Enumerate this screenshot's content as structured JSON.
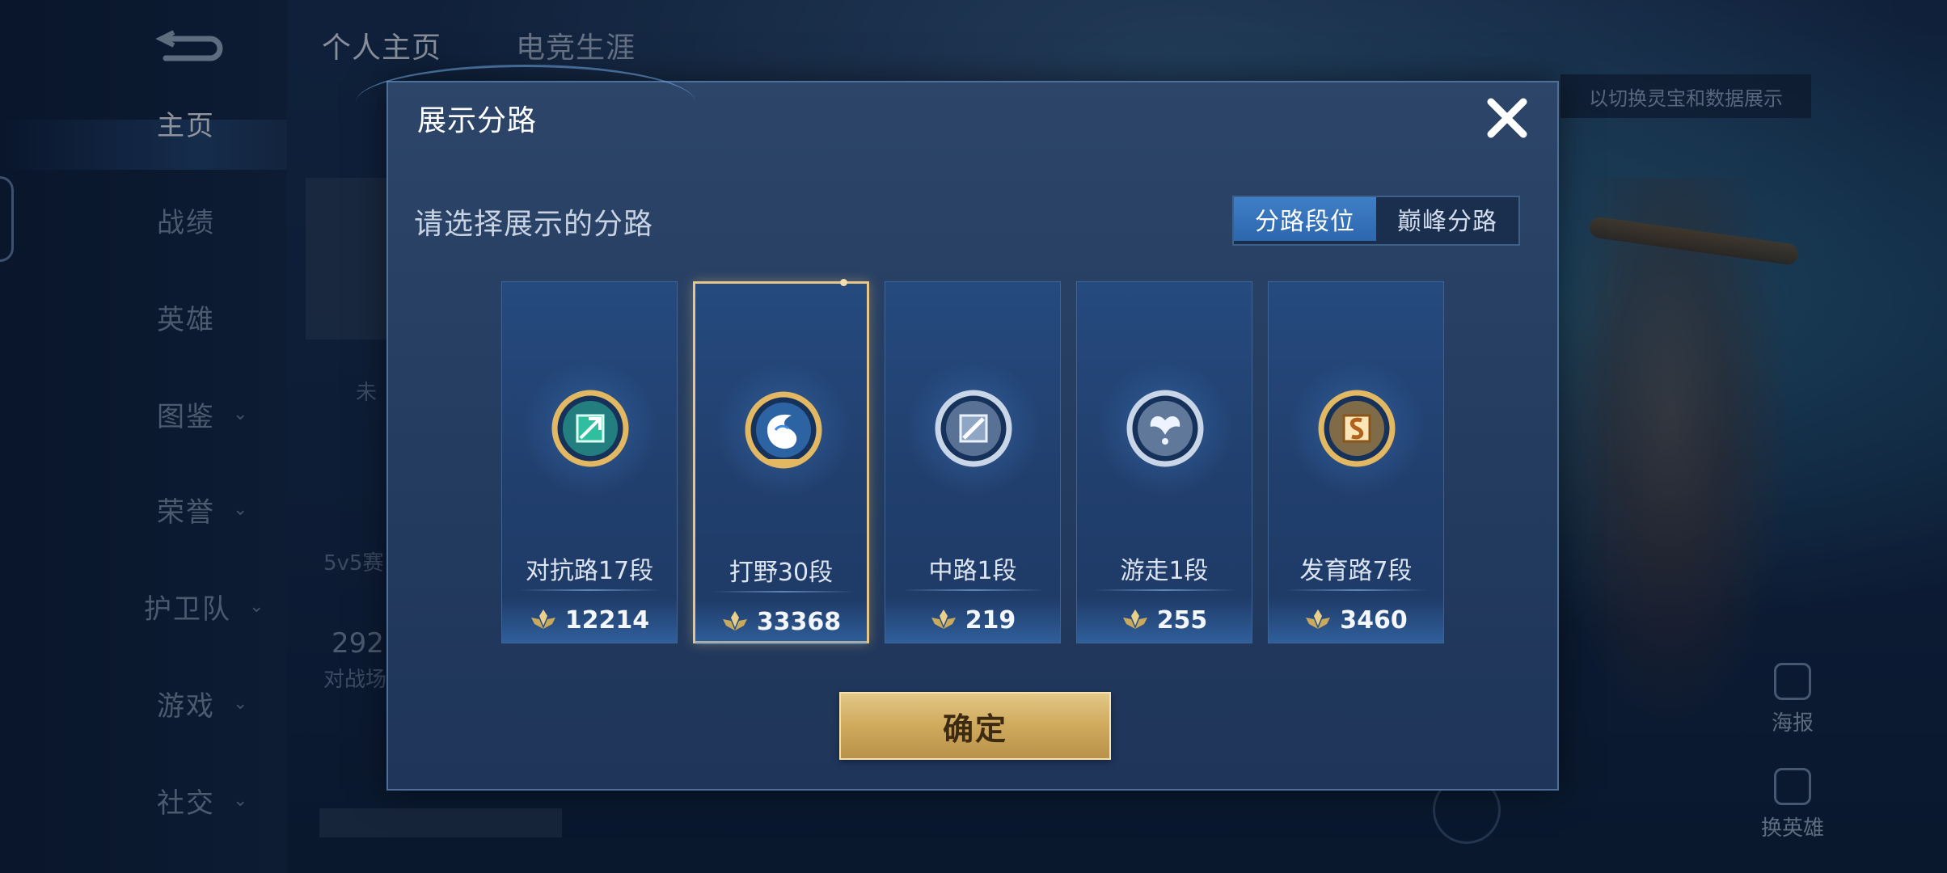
{
  "background": {
    "nav": {
      "items": [
        {
          "label": "主页",
          "has_chevron": false,
          "active": true
        },
        {
          "label": "战绩",
          "has_chevron": false,
          "active": false
        },
        {
          "label": "英雄",
          "has_chevron": false,
          "active": false
        },
        {
          "label": "图鉴",
          "has_chevron": true,
          "active": false
        },
        {
          "label": "荣誉",
          "has_chevron": true,
          "active": false
        },
        {
          "label": "护卫队",
          "has_chevron": true,
          "active": false
        },
        {
          "label": "游戏",
          "has_chevron": true,
          "active": false
        },
        {
          "label": "社交",
          "has_chevron": true,
          "active": false
        }
      ]
    },
    "top_tabs": {
      "personal": "个人主页",
      "career": "电竞生涯"
    },
    "fragments": {
      "unranked": "未",
      "mode": "5v5赛",
      "count": "292",
      "battle": "对战场"
    },
    "banner": "以切换灵宝和数据展示",
    "right_buttons": {
      "poster": "海报",
      "switch_hero": "换英雄"
    }
  },
  "dialog": {
    "title": "展示分路",
    "subtitle": "请选择展示的分路",
    "tabs": [
      {
        "label": "分路段位",
        "active": true
      },
      {
        "label": "巅峰分路",
        "active": false
      }
    ],
    "lanes": [
      {
        "label": "对抗路17段",
        "score": "12214",
        "badge": "clash-lane-badge-icon",
        "color": "#2fbf9e",
        "selected": false
      },
      {
        "label": "打野30段",
        "score": "33368",
        "badge": "jungle-badge-icon",
        "color": "#3f8de0",
        "selected": true
      },
      {
        "label": "中路1段",
        "score": "219",
        "badge": "mid-lane-badge-icon",
        "color": "#8fa6c4",
        "selected": false
      },
      {
        "label": "游走1段",
        "score": "255",
        "badge": "roam-badge-icon",
        "color": "#9fb4cf",
        "selected": false
      },
      {
        "label": "发育路7段",
        "score": "3460",
        "badge": "farm-lane-badge-icon",
        "color": "#d99a3c",
        "selected": false
      }
    ],
    "confirm_label": "确定"
  }
}
